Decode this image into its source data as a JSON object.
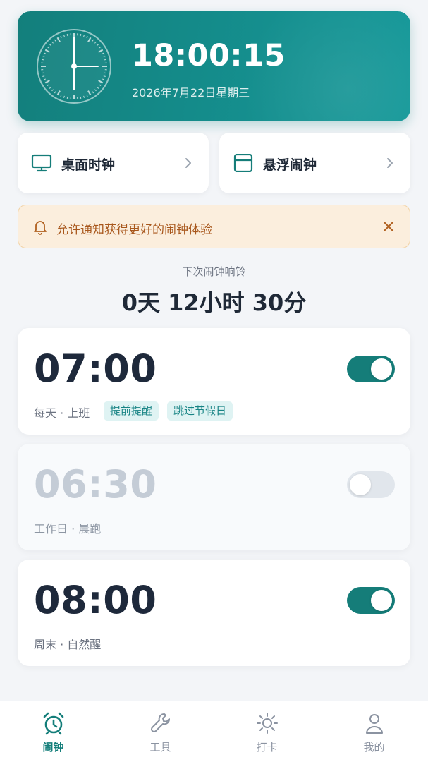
{
  "header": {
    "time": "18:00:15",
    "date": "2026年7月22日星期三"
  },
  "quick_actions": [
    {
      "label": "桌面时钟",
      "icon": "monitor-icon"
    },
    {
      "label": "悬浮闹钟",
      "icon": "window-icon"
    }
  ],
  "notice": {
    "text": "允许通知获得更好的闹钟体验",
    "icon": "bell-icon"
  },
  "next_alarm": {
    "label": "下次闹钟响铃",
    "value": "0天 12小时 30分"
  },
  "alarms": [
    {
      "time": "07:00",
      "desc": "每天 · 上班",
      "enabled": true,
      "tags": [
        "提前提醒",
        "跳过节假日"
      ]
    },
    {
      "time": "06:30",
      "desc": "工作日 · 晨跑",
      "enabled": false,
      "tags": []
    },
    {
      "time": "08:00",
      "desc": "周末 · 自然醒",
      "enabled": true,
      "tags": []
    }
  ],
  "nav": [
    {
      "label": "闹钟",
      "icon": "alarm-clock-icon",
      "active": true
    },
    {
      "label": "工具",
      "icon": "wrench-icon",
      "active": false
    },
    {
      "label": "打卡",
      "icon": "sun-icon",
      "active": false
    },
    {
      "label": "我的",
      "icon": "user-icon",
      "active": false
    }
  ],
  "colors": {
    "accent": "#157d79",
    "notice_bg": "#fbeedd",
    "notice_text": "#a8571c"
  }
}
